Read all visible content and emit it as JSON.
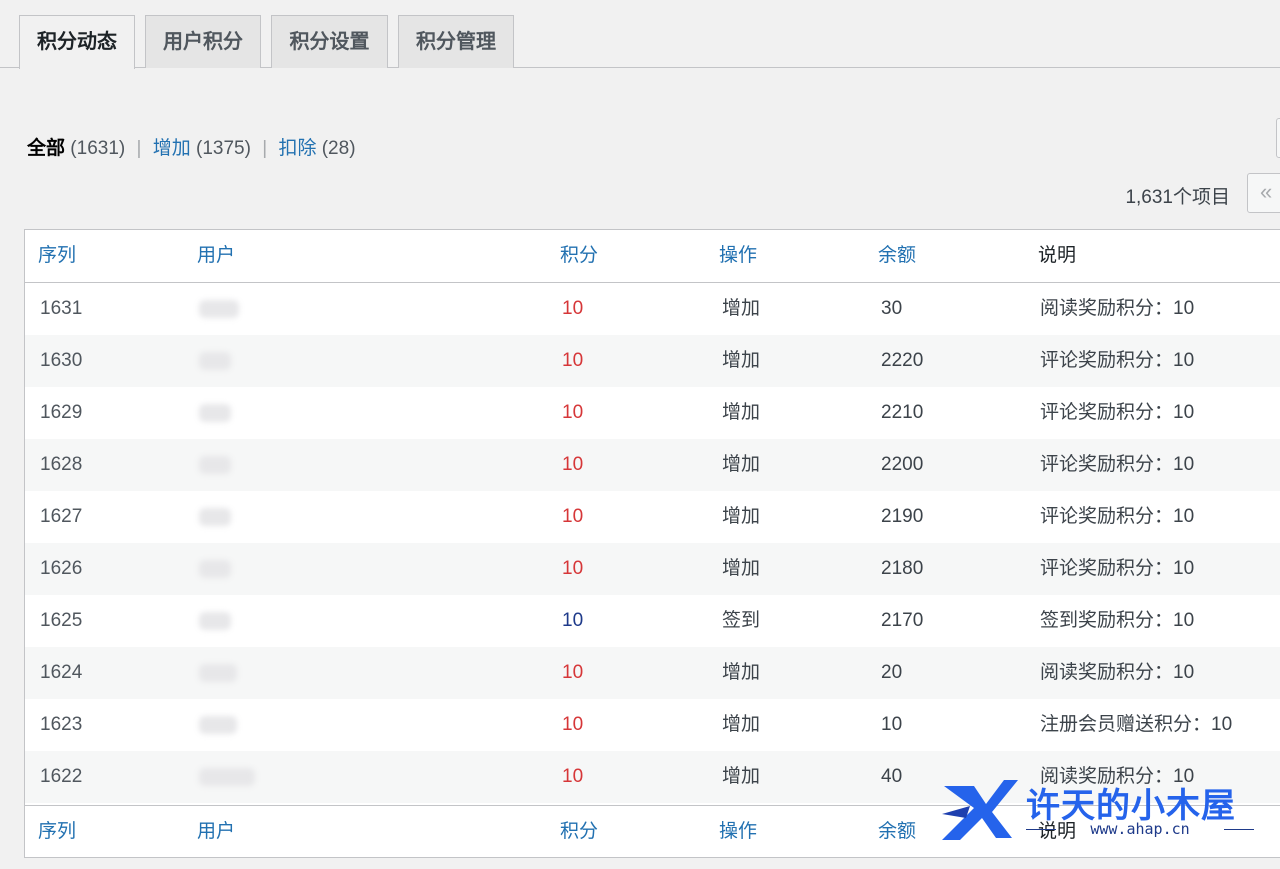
{
  "tabs": [
    {
      "label": "积分动态",
      "active": true
    },
    {
      "label": "用户积分",
      "active": false
    },
    {
      "label": "积分设置",
      "active": false
    },
    {
      "label": "积分管理",
      "active": false
    }
  ],
  "filters": {
    "all_label": "全部",
    "all_count": "(1631)",
    "add_label": "增加",
    "add_count": "(1375)",
    "deduct_label": "扣除",
    "deduct_count": "(28)",
    "separator": "|"
  },
  "pagination": {
    "items_text": "1,631个项目",
    "first_page_symbol": "«"
  },
  "table": {
    "columns": {
      "seq": "序列",
      "user": "用户",
      "points": "积分",
      "operation": "操作",
      "balance": "余额",
      "description": "说明"
    },
    "rows": [
      {
        "seq": "1631",
        "points": "10",
        "operation": "增加",
        "balance": "30",
        "description": "阅读奖励积分：10"
      },
      {
        "seq": "1630",
        "points": "10",
        "operation": "增加",
        "balance": "2220",
        "description": "评论奖励积分：10"
      },
      {
        "seq": "1629",
        "points": "10",
        "operation": "增加",
        "balance": "2210",
        "description": "评论奖励积分：10"
      },
      {
        "seq": "1628",
        "points": "10",
        "operation": "增加",
        "balance": "2200",
        "description": "评论奖励积分：10"
      },
      {
        "seq": "1627",
        "points": "10",
        "operation": "增加",
        "balance": "2190",
        "description": "评论奖励积分：10"
      },
      {
        "seq": "1626",
        "points": "10",
        "operation": "增加",
        "balance": "2180",
        "description": "评论奖励积分：10"
      },
      {
        "seq": "1625",
        "points": "10",
        "operation": "签到",
        "balance": "2170",
        "description": "签到奖励积分：10"
      },
      {
        "seq": "1624",
        "points": "10",
        "operation": "增加",
        "balance": "20",
        "description": "阅读奖励积分：10"
      },
      {
        "seq": "1623",
        "points": "10",
        "operation": "增加",
        "balance": "10",
        "description": "注册会员赠送积分：10"
      },
      {
        "seq": "1622",
        "points": "10",
        "operation": "增加",
        "balance": "40",
        "description": "阅读奖励积分：10"
      }
    ]
  },
  "watermark": {
    "title": "许天的小木屋",
    "url": "www.ahap.cn"
  },
  "colors": {
    "link": "#2271b1",
    "points_add": "#d63638",
    "points_checkin": "#1e3a8a"
  }
}
